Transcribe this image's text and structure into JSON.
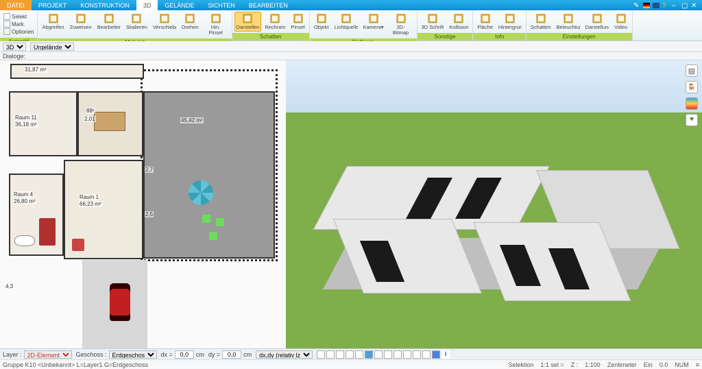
{
  "titlebar": {
    "file_tab": "DATEI",
    "tabs": [
      "PROJEKT",
      "KONSTRUKTION",
      "3D",
      "GELÄNDE",
      "SICHTEN",
      "BEARBEITEN"
    ],
    "active_tab_index": 2
  },
  "ribbon": {
    "groups": [
      {
        "label": "Auswahl",
        "side": [
          {
            "k": "Selekt"
          },
          {
            "k": "Mark."
          },
          {
            "k": "Optionen"
          }
        ]
      },
      {
        "label": "Material",
        "buttons": [
          {
            "k": "Abgreifen"
          },
          {
            "k": "Zuweisen"
          },
          {
            "k": "Bearbeiten"
          },
          {
            "k": "Skalieren"
          },
          {
            "k": "Verschieben"
          },
          {
            "k": "Drehen"
          },
          {
            "k": "Hin. Pinsel"
          }
        ]
      },
      {
        "label": "Schatten",
        "buttons": [
          {
            "k": "Darstellen",
            "active": true
          },
          {
            "k": "Rechnen"
          },
          {
            "k": "Pinsel"
          }
        ]
      },
      {
        "label": "Einfügen",
        "buttons": [
          {
            "k": "Objekt"
          },
          {
            "k": "Lichtquelle▾"
          },
          {
            "k": "Kamera▾"
          },
          {
            "k": "3D-Bitmap"
          }
        ]
      },
      {
        "label": "Sonstige",
        "buttons": [
          {
            "k": "3D Schrift"
          },
          {
            "k": "Kollision"
          }
        ]
      },
      {
        "label": "Info",
        "buttons": [
          {
            "k": "Fläche"
          },
          {
            "k": "Hintergrund"
          }
        ]
      },
      {
        "label": "Einstellungen",
        "buttons": [
          {
            "k": "Schatten"
          },
          {
            "k": "Beleuchtung"
          },
          {
            "k": "Darstellung"
          },
          {
            "k": "Video"
          }
        ]
      }
    ]
  },
  "subbar": {
    "mode": "3D",
    "surface": "Urgelände",
    "dialogs": "Dialoge:"
  },
  "plan": {
    "rooms": [
      {
        "name": "Raum 11",
        "area": "36,18 m²"
      },
      {
        "name": "Raum 4",
        "area": "26,80 m²"
      },
      {
        "name": "Raum 1",
        "area": "66,23 m²"
      }
    ],
    "top_area": "31,87 m²",
    "terrace_area": "45,42 m²",
    "dims": [
      "88¹",
      "2,01",
      "2,7",
      "2,5",
      "4,3"
    ]
  },
  "bottombar": {
    "layer_label": "Layer :",
    "layer_value": "2D-Element",
    "floor_label": "Geschoss :",
    "floor_value": "Erdgeschos",
    "dx_label": "dx =",
    "dx_value": "0,0",
    "dy_label": "dy =",
    "dy_value": "0,0",
    "unit": "cm",
    "rel": "dx,dy (relativ lz"
  },
  "statusbar": {
    "left": "Gruppe K10 <Unbekannt> L=Layer1 G=Erdgeschoss",
    "selection_label": "Selektion",
    "sel": "1:1 sel =",
    "zoom": "Z :",
    "scale": "1:100",
    "units": "Zentimeter",
    "snap": "Ein",
    "ortho": "0.0",
    "num": "NUM",
    "ready": "≡"
  }
}
